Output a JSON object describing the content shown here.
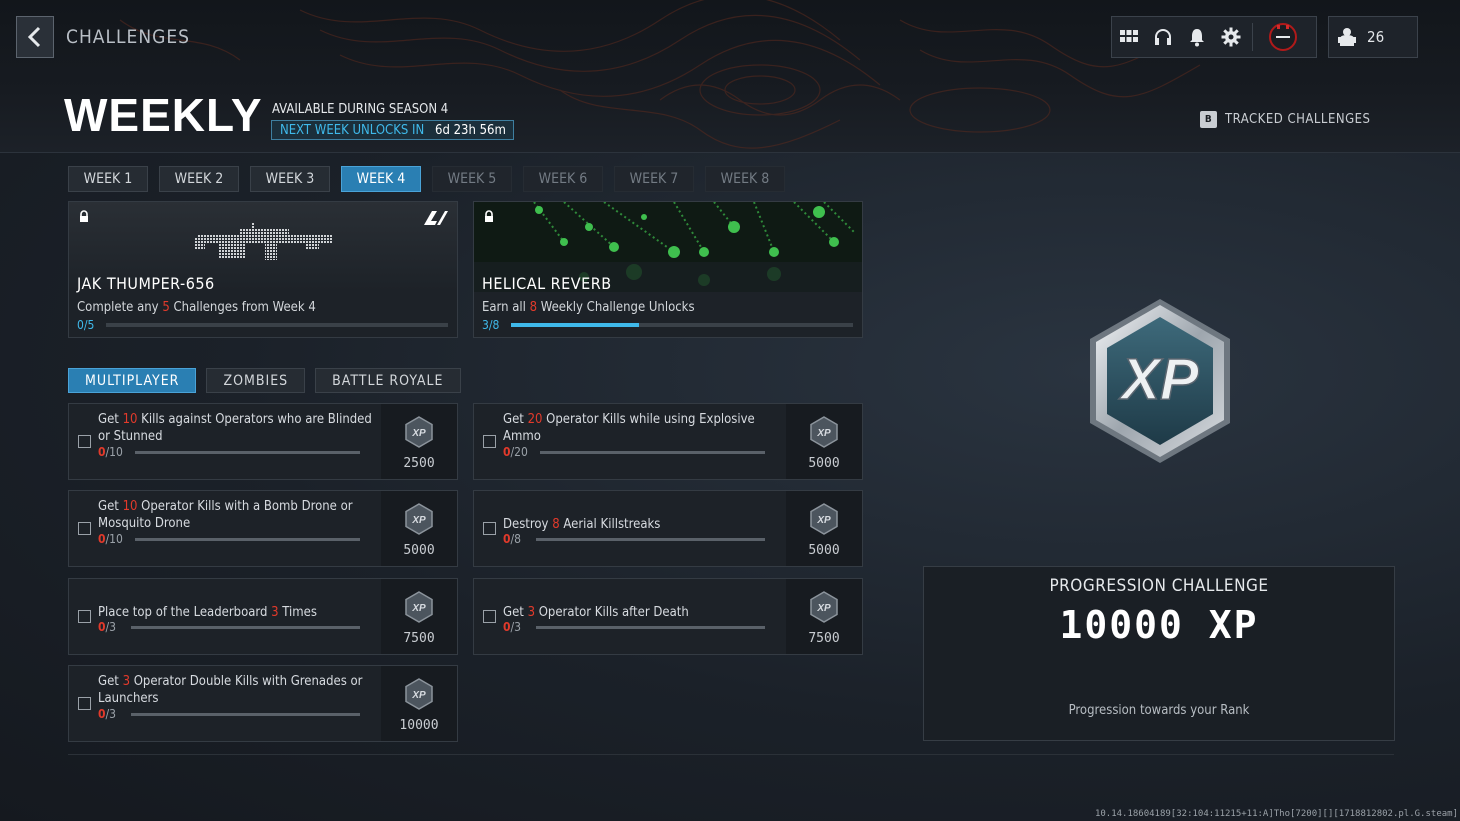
{
  "header": {
    "breadcrumb": "CHALLENGES",
    "title": "WEEKLY",
    "season_text": "AVAILABLE DURING SEASON 4",
    "next_week_label": "NEXT WEEK UNLOCKS IN",
    "next_week_time": "6d 23h 56m",
    "tracked_key": "B",
    "tracked_label": "TRACKED CHALLENGES",
    "rank_level": "26"
  },
  "icons": [
    "grid-icon",
    "headset-icon",
    "bell-icon",
    "gear-icon",
    "profile-icon",
    "operator-icon"
  ],
  "week_tabs": [
    "WEEK 1",
    "WEEK 2",
    "WEEK 3",
    "WEEK 4",
    "WEEK 5",
    "WEEK 6",
    "WEEK 7",
    "WEEK 8"
  ],
  "active_week": "WEEK 4",
  "rewards": [
    {
      "name": "JAK THUMPER-656",
      "desc_pre": "Complete any ",
      "desc_num": "5",
      "desc_post": " Challenges from Week 4",
      "progress": "0/5",
      "fraction": 0.0
    },
    {
      "name": "HELICAL REVERB",
      "desc_pre": "Earn all ",
      "desc_num": "8",
      "desc_post": " Weekly Challenge Unlocks",
      "progress": "3/8",
      "fraction": 0.375
    }
  ],
  "mode_tabs": [
    "MULTIPLAYER",
    "ZOMBIES",
    "BATTLE ROYALE"
  ],
  "challenges": [
    {
      "pre": "Get ",
      "num": "10",
      "post": " Kills against Operators who are Blinded or Stunned",
      "cur": "0",
      "total": "/10",
      "xp": "2500"
    },
    {
      "pre": "Get ",
      "num": "20",
      "post": " Operator Kills while using Explosive Ammo",
      "cur": "0",
      "total": "/20",
      "xp": "5000"
    },
    {
      "pre": "Get ",
      "num": "10",
      "post": " Operator Kills with a Bomb Drone or Mosquito Drone",
      "cur": "0",
      "total": "/10",
      "xp": "5000"
    },
    {
      "pre": "Destroy ",
      "num": "8",
      "post": " Aerial Killstreaks",
      "cur": "0",
      "total": "/8",
      "xp": "5000"
    },
    {
      "pre": "Place top of the Leaderboard ",
      "num": "3",
      "post": " Times",
      "cur": "0",
      "total": "/3",
      "xp": "7500"
    },
    {
      "pre": "Get ",
      "num": "3",
      "post": " Operator Kills after Death",
      "cur": "0",
      "total": "/3",
      "xp": "7500"
    },
    {
      "pre": "Get ",
      "num": "3",
      "post": " Operator Double Kills with Grenades or Launchers",
      "cur": "0",
      "total": "/3",
      "xp": "10000"
    }
  ],
  "xp_badge_text": "XP",
  "progression": {
    "heading": "PROGRESSION CHALLENGE",
    "xp": "10000 XP",
    "sub": "Progression towards your Rank"
  },
  "footer_text": "10.14.18604189[32:104:11215+11:A]Tho[7200][][1718812802.pl.G.steam]",
  "colors": {
    "accent": "#2a7fb3",
    "highlight": "#3fb9ea",
    "number_red": "#e23a2b"
  }
}
